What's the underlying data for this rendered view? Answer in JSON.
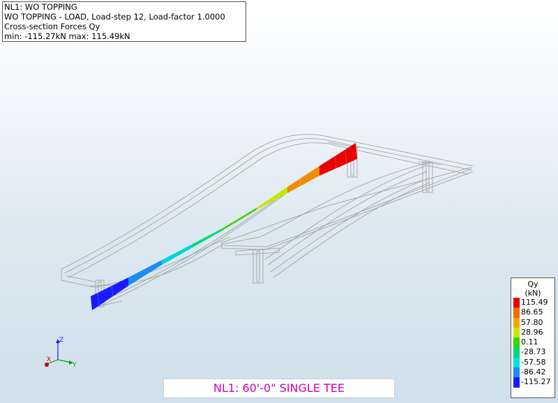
{
  "info": {
    "line1": "NL1: WO TOPPING",
    "line2": "WO TOPPING - LOAD, Load-step 12, Load-factor 1.0000",
    "line3": "Cross-section Forces Qy",
    "line4": "min: -115.27kN max: 115.49kN"
  },
  "legend": {
    "title": "Qy",
    "unit": "(kN)",
    "entries": [
      {
        "label": "115.49",
        "color": "#e80000"
      },
      {
        "label": "86.65",
        "color": "#f06a00"
      },
      {
        "label": "57.80",
        "color": "#f0a800"
      },
      {
        "label": "28.96",
        "color": "#c8e600"
      },
      {
        "label": "0.11",
        "color": "#3ad400"
      },
      {
        "label": "-28.73",
        "color": "#00d67a"
      },
      {
        "label": "-57.58",
        "color": "#00e0e0"
      },
      {
        "label": "-86.42",
        "color": "#1e8cf0"
      },
      {
        "label": "-115.27",
        "color": "#1a1aff"
      }
    ]
  },
  "caption": "NL1: 60'-0\" SINGLE TEE",
  "axes": {
    "z": "Z",
    "y": "Y",
    "x": "X"
  }
}
